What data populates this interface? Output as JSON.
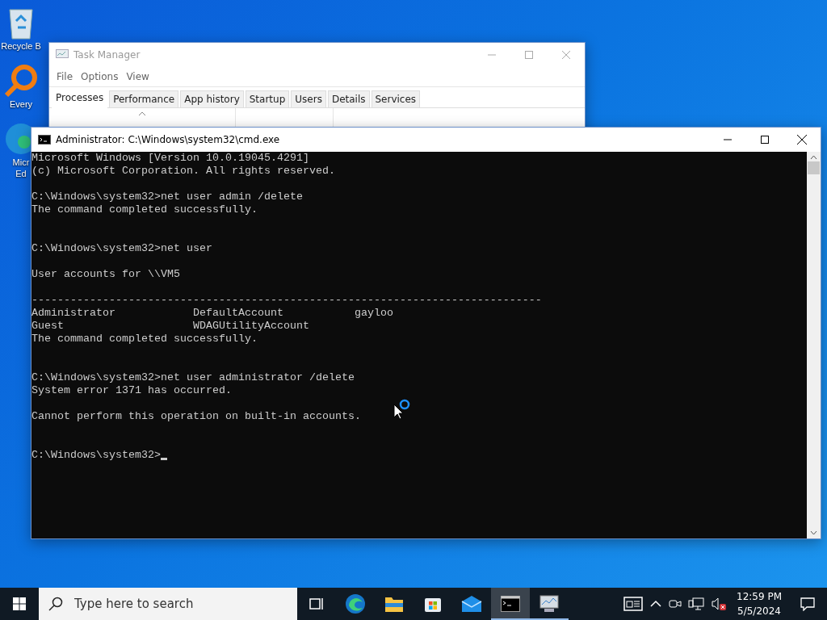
{
  "desktop_icons": [
    {
      "kind": "recycle-bin",
      "label": "Recycle B"
    },
    {
      "kind": "search-app",
      "label": "Every"
    },
    {
      "kind": "edge",
      "label": "Micr",
      "label_2": "Ed"
    }
  ],
  "task_manager": {
    "title": "Task Manager",
    "menu": [
      "File",
      "Options",
      "View"
    ],
    "tabs": [
      {
        "label": "Processes",
        "selected": true
      },
      {
        "label": "Performance",
        "selected": false
      },
      {
        "label": "App history",
        "selected": false
      },
      {
        "label": "Startup",
        "selected": false
      },
      {
        "label": "Users",
        "selected": false
      },
      {
        "label": "Details",
        "selected": false
      },
      {
        "label": "Services",
        "selected": false
      }
    ]
  },
  "console": {
    "title": "Administrator: C:\\Windows\\system32\\cmd.exe",
    "lines": [
      {
        "kind": "text",
        "text": "Microsoft Windows [Version 10.0.19045.4291]"
      },
      {
        "kind": "text",
        "text": "(c) Microsoft Corporation. All rights reserved."
      },
      {
        "kind": "blank"
      },
      {
        "kind": "text",
        "text": "C:\\Windows\\system32>net user admin /delete"
      },
      {
        "kind": "text",
        "text": "The command completed successfully."
      },
      {
        "kind": "blank"
      },
      {
        "kind": "blank"
      },
      {
        "kind": "text",
        "text": "C:\\Windows\\system32>net user"
      },
      {
        "kind": "blank"
      },
      {
        "kind": "text",
        "text": "User accounts for \\\\VM5"
      },
      {
        "kind": "blank"
      },
      {
        "kind": "text",
        "text": "-------------------------------------------------------------------------------"
      },
      {
        "kind": "text",
        "text": "Administrator            DefaultAccount           gayloo"
      },
      {
        "kind": "text",
        "text": "Guest                    WDAGUtilityAccount"
      },
      {
        "kind": "text",
        "text": "The command completed successfully."
      },
      {
        "kind": "blank"
      },
      {
        "kind": "blank"
      },
      {
        "kind": "text",
        "text": "C:\\Windows\\system32>net user administrator /delete"
      },
      {
        "kind": "text",
        "text": "System error 1371 has occurred."
      },
      {
        "kind": "blank"
      },
      {
        "kind": "text",
        "text": "Cannot perform this operation on built-in accounts."
      },
      {
        "kind": "blank"
      },
      {
        "kind": "blank"
      },
      {
        "kind": "prompt",
        "text": "C:\\Windows\\system32>"
      }
    ]
  },
  "taskbar": {
    "search": {
      "placeholder": "Type here to search"
    },
    "apps": [
      {
        "kind": "task-view",
        "selected": false,
        "running": false
      },
      {
        "kind": "edge",
        "selected": false,
        "running": false
      },
      {
        "kind": "explorer",
        "selected": false,
        "running": false
      },
      {
        "kind": "store",
        "selected": false,
        "running": false
      },
      {
        "kind": "mail",
        "selected": false,
        "running": false
      },
      {
        "kind": "terminal",
        "selected": true,
        "running": true
      },
      {
        "kind": "task-manager",
        "selected": false,
        "running": true
      }
    ],
    "tray": [
      {
        "kind": "news"
      },
      {
        "kind": "chevron"
      },
      {
        "kind": "camera"
      },
      {
        "kind": "network"
      },
      {
        "kind": "volume-muted"
      }
    ],
    "time": "12:59 PM",
    "date": "5/5/2024"
  }
}
